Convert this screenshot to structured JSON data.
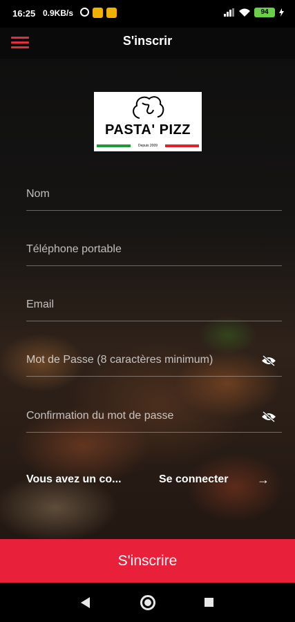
{
  "status_bar": {
    "time": "16:25",
    "speed": "0.9KB/s",
    "battery": "94"
  },
  "header": {
    "title": "S'inscrir"
  },
  "logo": {
    "name": "PASTA' PIZZ",
    "tagline": "Depuis 2009",
    "stripe_colors": [
      "#1f9a3a",
      "#ffffff",
      "#e0202a"
    ]
  },
  "form": {
    "name_placeholder": "Nom",
    "phone_placeholder": "Téléphone portable",
    "email_placeholder": "Email",
    "password_placeholder": "Mot de Passe (8 caractères minimum)",
    "confirm_placeholder": "Confirmation du mot de passe"
  },
  "login": {
    "question": "Vous avez un co...",
    "link": "Se connecter",
    "arrow": "→"
  },
  "submit_label": "S'inscrire",
  "colors": {
    "accent": "#e8203a",
    "menu_icon": "#e03040"
  }
}
